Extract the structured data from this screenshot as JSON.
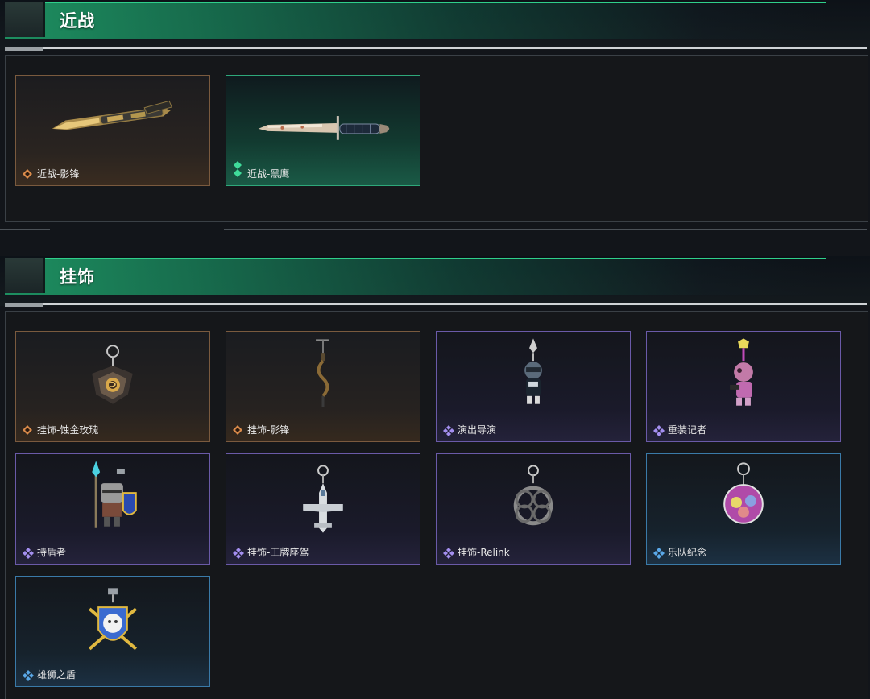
{
  "sections": [
    {
      "title": "近战",
      "items": [
        {
          "label": "近战-影锋",
          "rarity": "orange",
          "icon": "orange-rarity-icon",
          "art": "butterfly-knife-icon"
        },
        {
          "label": "近战-黑鹰",
          "rarity": "green",
          "icon": "green-rarity-icon",
          "art": "combat-knife-icon"
        }
      ]
    },
    {
      "title": "挂饰",
      "items": [
        {
          "label": "挂饰-蚀金玫瑰",
          "rarity": "orange",
          "icon": "orange-rarity-icon",
          "art": "rose-charm-icon"
        },
        {
          "label": "挂饰-影锋",
          "rarity": "orange",
          "icon": "orange-rarity-icon",
          "art": "shadow-charm-icon"
        },
        {
          "label": "演出导演",
          "rarity": "purple",
          "icon": "purple-rarity-icon",
          "art": "director-figure-icon"
        },
        {
          "label": "重装记者",
          "rarity": "purple",
          "icon": "purple-rarity-icon",
          "art": "reporter-figure-icon"
        },
        {
          "label": "持盾者",
          "rarity": "purple",
          "icon": "purple-rarity-icon",
          "art": "shield-bearer-figure-icon"
        },
        {
          "label": "挂饰-王牌座驾",
          "rarity": "purple",
          "icon": "purple-rarity-icon",
          "art": "jet-charm-icon"
        },
        {
          "label": "挂饰-Relink",
          "rarity": "purple",
          "icon": "purple-rarity-icon",
          "art": "relink-charm-icon"
        },
        {
          "label": "乐队纪念",
          "rarity": "blue",
          "icon": "blue-rarity-icon",
          "art": "band-badge-charm-icon"
        },
        {
          "label": "雄狮之盾",
          "rarity": "blue",
          "icon": "blue-rarity-icon",
          "art": "lion-shield-charm-icon"
        }
      ]
    }
  ],
  "colors": {
    "accent_green": "#2fcf8a",
    "rarity_orange": "#b6835a",
    "rarity_green": "#3fcf96",
    "rarity_purple": "#7a6ac2",
    "rarity_blue": "#4a8fbf"
  }
}
